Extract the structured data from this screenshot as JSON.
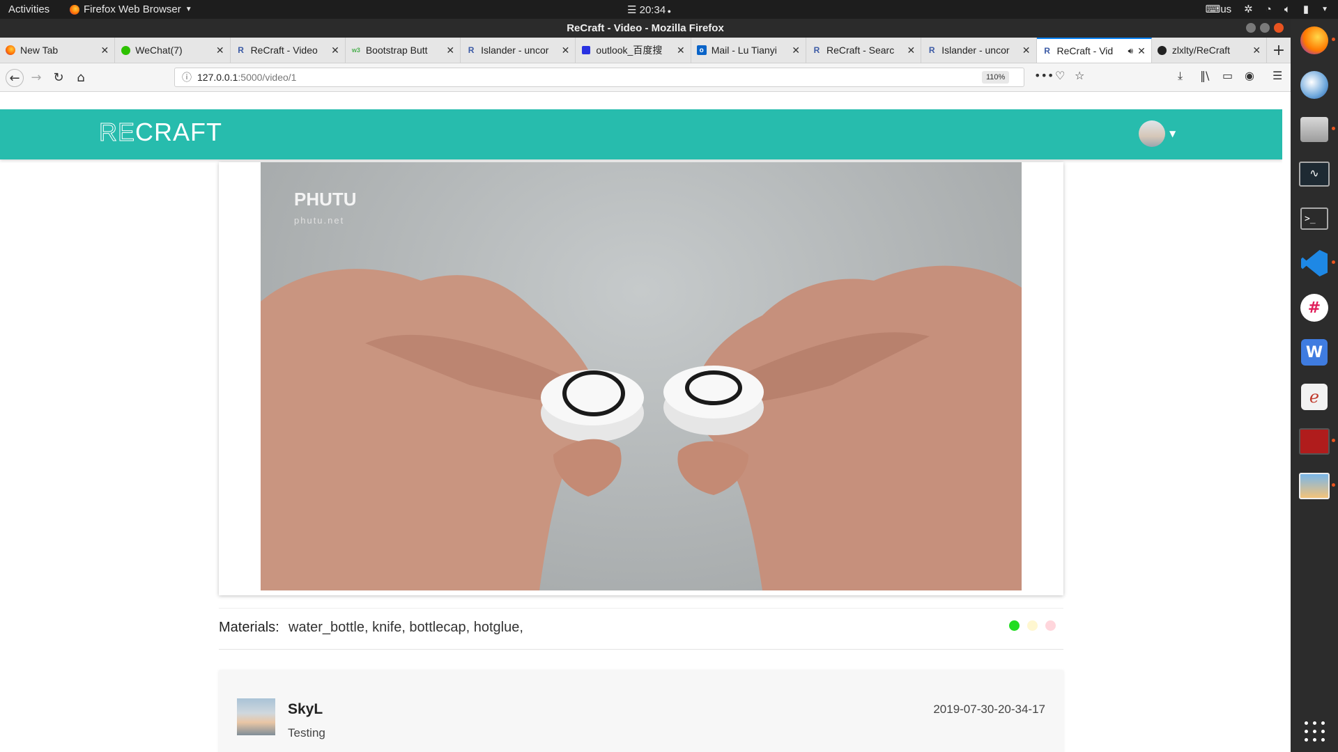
{
  "top_panel": {
    "activities": "Activities",
    "app_name": "Firefox Web Browser",
    "clock": "20:34",
    "keyboard_layout": "us"
  },
  "window": {
    "title": "ReCraft - Video - Mozilla Firefox"
  },
  "tabs": [
    {
      "label": "New Tab",
      "icon": "firefox-icon",
      "favicon_text": ""
    },
    {
      "label": "WeChat(7)",
      "icon": "wechat-icon",
      "favicon_text": ""
    },
    {
      "label": "ReCraft - Video",
      "icon": "recraft-icon",
      "favicon_text": "R"
    },
    {
      "label": "Bootstrap Butt",
      "icon": "bootstrap-icon",
      "favicon_text": "w3"
    },
    {
      "label": "Islander - uncor",
      "icon": "recraft-icon",
      "favicon_text": "R"
    },
    {
      "label": "outlook_百度搜",
      "icon": "baidu-icon",
      "favicon_text": ""
    },
    {
      "label": "Mail - Lu Tianyi",
      "icon": "outlook-icon",
      "favicon_text": "o"
    },
    {
      "label": "ReCraft - Searc",
      "icon": "recraft-icon",
      "favicon_text": "R"
    },
    {
      "label": "Islander - uncor",
      "icon": "recraft-icon",
      "favicon_text": "R"
    },
    {
      "label": "ReCraft - Vid",
      "icon": "recraft-icon",
      "favicon_text": "R",
      "active": true,
      "audio": true
    },
    {
      "label": "zlxlty/ReCraft",
      "icon": "github-icon",
      "favicon_text": ""
    }
  ],
  "navbar": {
    "url_host": "127.0.0.1",
    "url_path": ":5000/video/1",
    "zoom": "110%",
    "overflow_label": "•••"
  },
  "site": {
    "brand_outline": "RE",
    "brand_solid": "CRAFT",
    "header_color": "#27bcad"
  },
  "video": {
    "watermark_brand": "PHUTU",
    "watermark_url": "phutu.net"
  },
  "materials": {
    "label": "Materials:",
    "value": "water_bottle, knife, bottlecap, hotglue,",
    "status_dots": [
      "#22dd22",
      "#fff7d0",
      "#ffd6dc"
    ]
  },
  "comment": {
    "user": "SkyL",
    "text": "Testing",
    "timestamp": "2019-07-30-20-34-17"
  },
  "dock": {
    "items": [
      "firefox-icon",
      "thunderbird-icon",
      "files-icon",
      "system-monitor-icon",
      "terminal-icon",
      "vscode-icon",
      "slack-icon",
      "wps-writer-icon",
      "draw-icon",
      "screen-recorder-icon",
      "photos-icon"
    ]
  }
}
